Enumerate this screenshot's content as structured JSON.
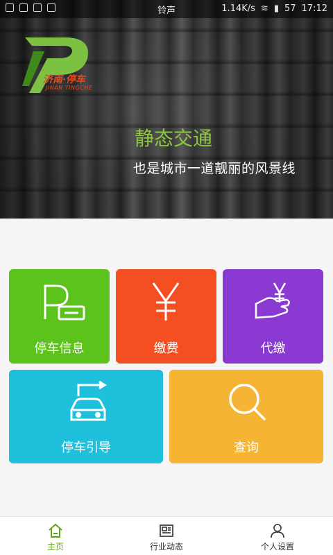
{
  "status_bar": {
    "ringer": "铃声",
    "speed": "1.14K/s",
    "battery": "57",
    "time": "17:12"
  },
  "banner": {
    "logo_cn": "济南·停车",
    "logo_en": "JINAN TINGCHE",
    "title": "静态交通",
    "subtitle": "也是城市一道靓丽的风景线",
    "title_color": "#8dc63f"
  },
  "tiles": [
    {
      "label": "停车信息",
      "icon": "parking-icon",
      "color": "#5cc21c"
    },
    {
      "label": "缴费",
      "icon": "yen-icon",
      "color": "#f34f23"
    },
    {
      "label": "代缴",
      "icon": "hand-yen-icon",
      "color": "#8a39d2"
    },
    {
      "label": "停车引导",
      "icon": "car-arrow-icon",
      "color": "#1fc0dc"
    },
    {
      "label": "查询",
      "icon": "search-icon",
      "color": "#f5b434"
    }
  ],
  "bottom_nav": [
    {
      "label": "主页",
      "icon": "home-icon",
      "active": true
    },
    {
      "label": "行业动态",
      "icon": "news-icon",
      "active": false
    },
    {
      "label": "个人设置",
      "icon": "person-icon",
      "active": false
    }
  ],
  "accent_color": "#5fa517"
}
